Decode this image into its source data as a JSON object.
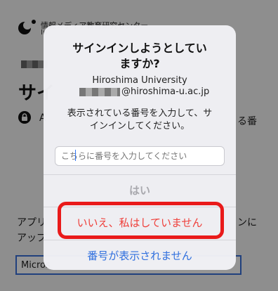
{
  "background": {
    "logo_text": "情報メディア教育研究センター",
    "logo_sub": "In",
    "heading": "サイ",
    "row_a": "A",
    "row_b": "",
    "row_right": "る番",
    "app_line_1": "アプリ",
    "app_line_2": "アップ",
    "app_right": "ンに",
    "ms_box": "Micros"
  },
  "dialog": {
    "title_line_1": "サインインしようとしてい",
    "title_line_2": "ますか?",
    "organization": "Hiroshima University",
    "email_suffix": "@hiroshima-u.ac.jp",
    "instruction_line_1": "表示されている番号を入力して、サ",
    "instruction_line_2": "インインしてください。",
    "code_placeholder": "こちらに番号を入力してください",
    "yes_label": "はい",
    "no_label": "いいえ、私はしていません",
    "not_shown_label": "番号が表示されません"
  },
  "colors": {
    "highlight": "#e91a1a",
    "destructive": "#ef3f3a",
    "link": "#2f6fde",
    "disabled": "#a8a8ad"
  }
}
